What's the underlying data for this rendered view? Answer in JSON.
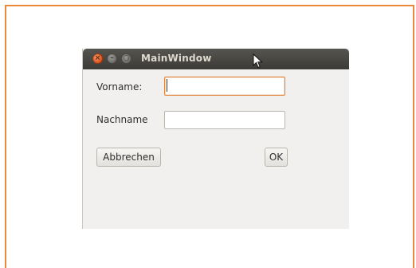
{
  "window": {
    "title": "MainWindow"
  },
  "form": {
    "vorname_label": "Vorname:",
    "vorname_value": "",
    "nachname_label": "Nachname",
    "nachname_value": ""
  },
  "buttons": {
    "cancel_label": "Abbrechen",
    "ok_label": "OK"
  },
  "icons": {
    "close": "close-icon",
    "minimize": "minimize-icon",
    "maximize": "maximize-icon",
    "cursor": "mouse-pointer-icon"
  },
  "colors": {
    "accent": "#ec8a3a",
    "titlebar": "#3d3b37",
    "close_button": "#e0521f"
  }
}
